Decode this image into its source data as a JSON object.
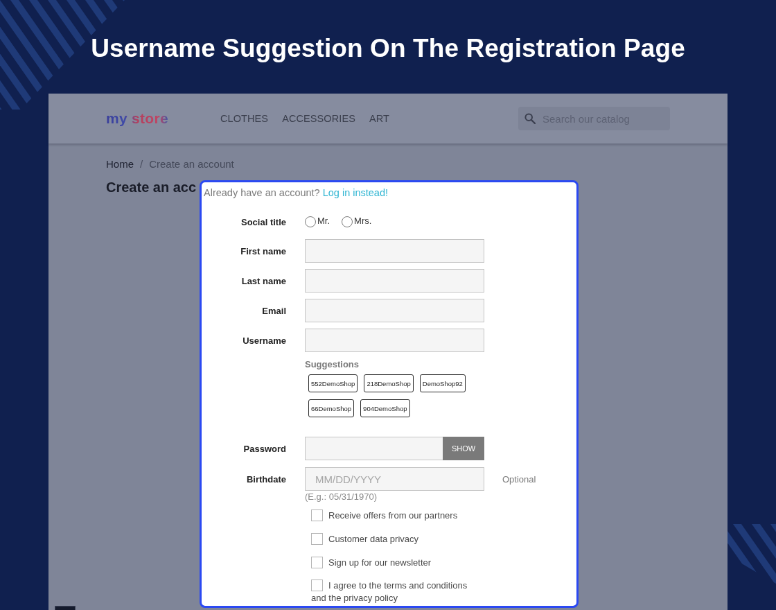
{
  "title": "Username Suggestion On The Registration Page",
  "store": {
    "logo": "my store",
    "nav": [
      {
        "label": "CLOTHES"
      },
      {
        "label": "ACCESSORIES"
      },
      {
        "label": "ART"
      }
    ],
    "search": {
      "placeholder": "Search our catalog"
    },
    "breadcrumb": {
      "items": [
        {
          "label": "Home"
        },
        {
          "label": "Create an account"
        }
      ],
      "separator": "/"
    },
    "heading": "Create an acc"
  },
  "dialog": {
    "prompt": "Already have an account?",
    "link": "Log in instead!",
    "fields": [
      {
        "kind": "radio",
        "label": "Social title",
        "options": [
          {
            "label": "Mr.",
            "selected": false
          },
          {
            "label": "Mrs.",
            "selected": false
          }
        ]
      },
      {
        "kind": "text",
        "label": "First name"
      },
      {
        "kind": "text",
        "label": "Last name"
      },
      {
        "kind": "text",
        "label": "Email"
      },
      {
        "kind": "suggest",
        "label": "Username",
        "suggestions_title": "Suggestions",
        "suggestions": [
          "552DemoShop",
          "218DemoShop",
          "DemoShop92",
          "66DemoShop",
          "904DemoShop"
        ]
      },
      {
        "kind": "password",
        "label": "Password",
        "button": "SHOW"
      },
      {
        "kind": "date",
        "label": "Birthdate",
        "placeholder": "MM/DD/YYYY",
        "note": "Optional",
        "hint": "(E.g.: 05/31/1970)"
      }
    ],
    "checkboxes": [
      {
        "label": "Receive offers from our partners",
        "checked": false
      },
      {
        "label": "Customer data privacy",
        "checked": false
      },
      {
        "label": "Sign up for our newsletter",
        "checked": false
      },
      {
        "label": "I agree to the terms and conditions and the privacy policy",
        "checked": false
      }
    ]
  }
}
